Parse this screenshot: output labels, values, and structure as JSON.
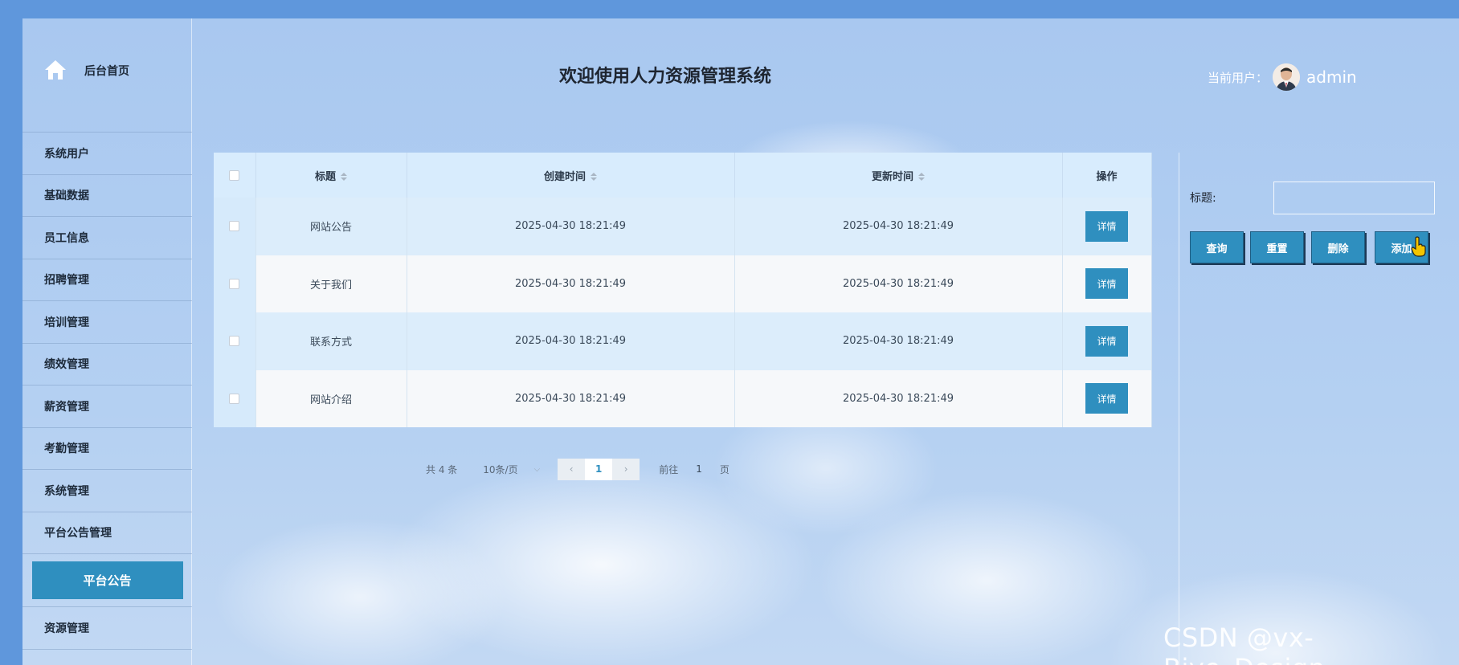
{
  "sidebar": {
    "home_label": "后台首页",
    "items": [
      {
        "label": "系统用户"
      },
      {
        "label": "基础数据"
      },
      {
        "label": "员工信息"
      },
      {
        "label": "招聘管理"
      },
      {
        "label": "培训管理"
      },
      {
        "label": "绩效管理"
      },
      {
        "label": "薪资管理"
      },
      {
        "label": "考勤管理"
      },
      {
        "label": "系统管理"
      },
      {
        "label": "平台公告管理"
      }
    ],
    "active_sub": "平台公告",
    "after_items": [
      {
        "label": "资源管理"
      }
    ]
  },
  "header": {
    "title": "欢迎使用人力资源管理系统",
    "user_label": "当前用户：",
    "user_name": "admin"
  },
  "table": {
    "columns": [
      "标题",
      "创建时间",
      "更新时间",
      "操作"
    ],
    "rows": [
      {
        "title": "网站公告",
        "created": "2025-04-30 18:21:49",
        "updated": "2025-04-30 18:21:49",
        "action": "详情"
      },
      {
        "title": "关于我们",
        "created": "2025-04-30 18:21:49",
        "updated": "2025-04-30 18:21:49",
        "action": "详情"
      },
      {
        "title": "联系方式",
        "created": "2025-04-30 18:21:49",
        "updated": "2025-04-30 18:21:49",
        "action": "详情"
      },
      {
        "title": "网站介绍",
        "created": "2025-04-30 18:21:49",
        "updated": "2025-04-30 18:21:49",
        "action": "详情"
      }
    ]
  },
  "pager": {
    "total": "共 4 条",
    "page_size": "10条/页",
    "prev": "‹",
    "current": "1",
    "next": "›",
    "goto_label": "前往",
    "goto_value": "1",
    "goto_suffix": "页"
  },
  "search": {
    "label": "标题:",
    "value": ""
  },
  "actions": {
    "query": "查询",
    "reset": "重置",
    "delete": "删除",
    "add": "添加"
  },
  "watermark": "CSDN @vx-Biye_Design",
  "colors": {
    "accent": "#2f8fbf",
    "page_bg": "#5f97dc"
  }
}
